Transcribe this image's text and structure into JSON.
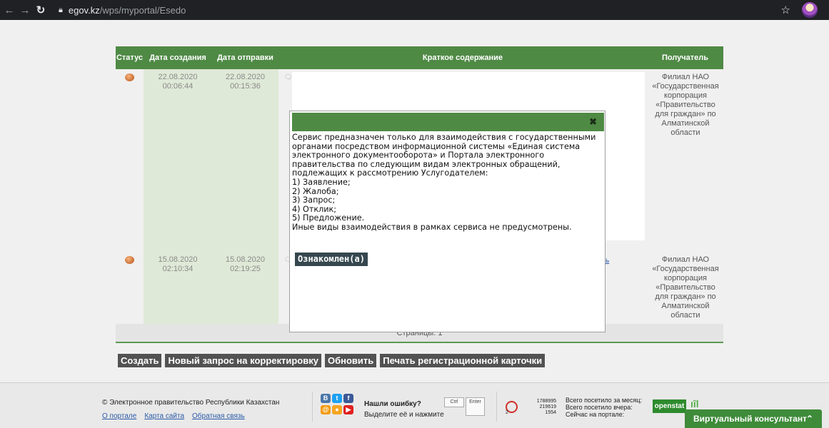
{
  "browser": {
    "url_host": "egov.kz",
    "url_path": "/wps/myportal/Esedo"
  },
  "table": {
    "headers": {
      "status": "Статус",
      "created": "Дата создания",
      "sent": "Дата отправки",
      "summary": "Краткое содержание",
      "recipient": "Получатель"
    },
    "rows": [
      {
        "created_date": "22.08.2020",
        "created_time": "00:06:44",
        "sent_date": "22.08.2020",
        "sent_time": "00:15:36",
        "recipient": "Филиал НАО «Государственная корпорация «Правительство для граждан» по Алматинской области"
      },
      {
        "created_date": "15.08.2020",
        "created_time": "02:10:34",
        "sent_date": "15.08.2020",
        "sent_time": "02:19:25",
        "link_fragment": "ь",
        "recipient": "Филиал НАО «Государственная корпорация «Правительство для граждан» по Алматинской области"
      }
    ],
    "pager": "Страницы: 1"
  },
  "dialog": {
    "close_glyph": "✖",
    "lines": [
      "Сервис предназначен только для взаимодействия с государственными",
      "органами посредством информационной системы «Единая система",
      "электронного документооборота» и Портала электронного",
      "правительства по следующим видам электронных обращений,",
      "подлежащих к рассмотрению Услугодателем:",
      "1) Заявление;",
      "2) Жалоба;",
      "3) Запрос;",
      "4) Отклик;",
      "5) Предложение.",
      "Иные виды взаимодействия в рамках сервиса не предусмотрены."
    ],
    "ack_button": "Ознакомлен(а)"
  },
  "actions": {
    "create": "Создать",
    "new_correction": "Новый запрос на корректировку",
    "refresh": "Обновить",
    "print_card": "Печать регистрационной карточки"
  },
  "footer": {
    "copyright": "© Электронное правительство Республики Казахстан",
    "links": {
      "about": "О портале",
      "sitemap": "Карта сайта",
      "feedback": "Обратная связь"
    },
    "found_error_title": "Нашли ошибку?",
    "found_error_text": "Выделите её и нажмите",
    "key_ctrl": "Ctrl",
    "key_enter": "Enter",
    "counter": {
      "n1": "1788995",
      "n2": "219619",
      "n3": "1554",
      "small": "2"
    },
    "visits": {
      "month": "Всего посетило за месяц:",
      "yesterday": "Всего посетило вчера:",
      "now": "Сейчас на портале:"
    },
    "openstat": "openstat",
    "consultant": "Виртуальный консультант"
  },
  "colors": {
    "header_green": "#4f8a45",
    "column_tint": "#dfe9d7",
    "button_dark": "#525252"
  }
}
